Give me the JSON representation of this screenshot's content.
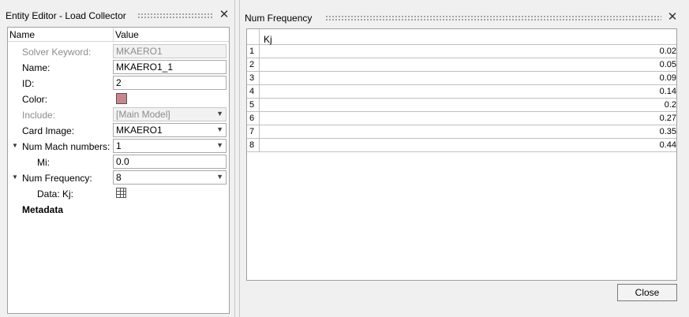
{
  "entity_editor": {
    "title": "Entity Editor - Load Collector",
    "close_glyph": "✕",
    "headers": {
      "name": "Name",
      "value": "Value"
    },
    "rows": {
      "solver_keyword": {
        "label": "Solver Keyword:",
        "value": "MKAERO1"
      },
      "name": {
        "label": "Name:",
        "value": "MKAERO1_1"
      },
      "id": {
        "label": "ID:",
        "value": "2"
      },
      "color": {
        "label": "Color:",
        "swatch": "#c8868c"
      },
      "include": {
        "label": "Include:",
        "value": "[Main Model]"
      },
      "card_image": {
        "label": "Card Image:",
        "value": "MKAERO1"
      },
      "num_mach": {
        "label": "Num Mach numbers:",
        "value": "1"
      },
      "mi": {
        "label": "Mi:",
        "value": "0.0"
      },
      "num_freq": {
        "label": "Num Frequency:",
        "value": "8"
      },
      "data_kj": {
        "label": "Data: Kj:",
        "icon": "table-edit-icon"
      },
      "metadata": {
        "label": "Metadata"
      }
    }
  },
  "num_frequency": {
    "title": "Num Frequency",
    "close_glyph": "✕",
    "column": "Kj",
    "rows": [
      {
        "n": "1",
        "kj": "0.02"
      },
      {
        "n": "2",
        "kj": "0.05"
      },
      {
        "n": "3",
        "kj": "0.09"
      },
      {
        "n": "4",
        "kj": "0.14"
      },
      {
        "n": "5",
        "kj": "0.2"
      },
      {
        "n": "6",
        "kj": "0.27"
      },
      {
        "n": "7",
        "kj": "0.35"
      },
      {
        "n": "8",
        "kj": "0.44"
      }
    ],
    "close_button": "Close"
  }
}
